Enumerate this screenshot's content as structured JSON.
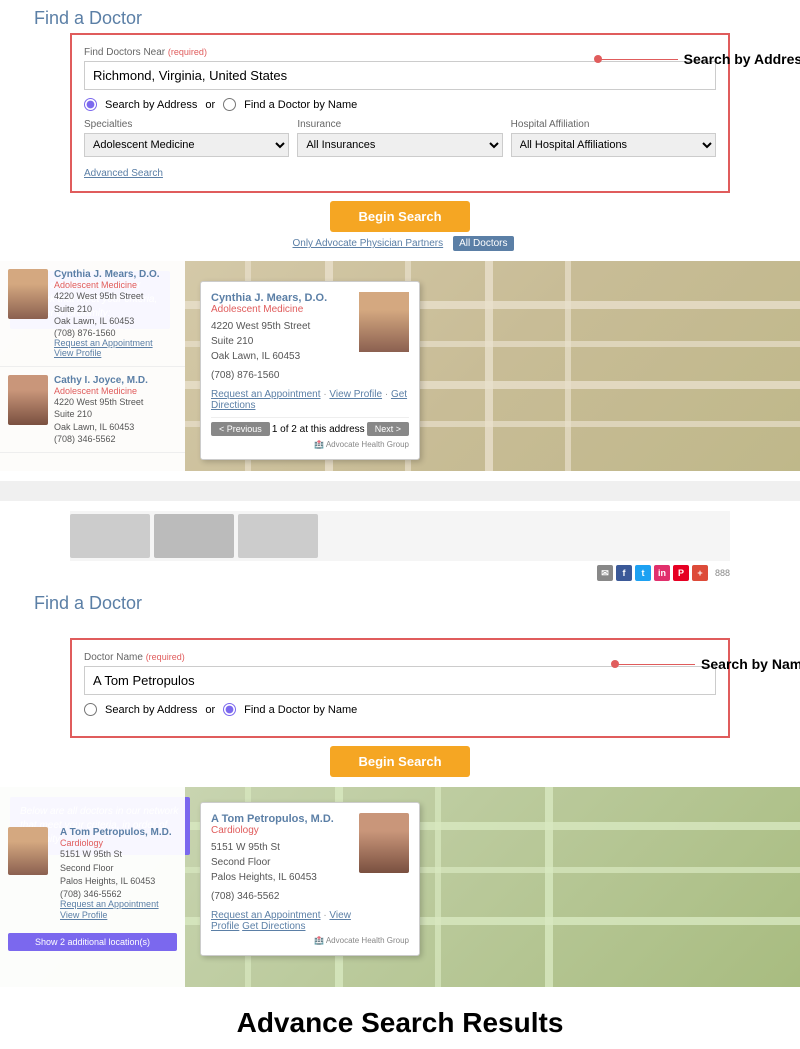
{
  "page": {
    "title1": "Find a Doctor",
    "title2": "Find a Doctor"
  },
  "search1": {
    "form_label": "Find Doctors Near",
    "required_label": "(required)",
    "address_value": "Richmond, Virginia, United States",
    "address_placeholder": "Richmond, Virginia, United States",
    "radio_address": "Search by Address",
    "radio_or": "or",
    "radio_name": "Find a Doctor by Name",
    "specialties_label": "Specialties",
    "insurance_label": "Insurance",
    "hospital_label": "Hospital Affiliation",
    "specialty_value": "Adolescent Medicine",
    "insurance_value": "All Insurances",
    "hospital_value": "All Hospital Affiliations",
    "advanced_link": "Advanced Search",
    "begin_btn": "Begin Search",
    "filter_only": "Only Advocate Physician Partners",
    "filter_all": "All Doctors",
    "annotation": "Search by Address"
  },
  "doctor1": {
    "name": "Cynthia J. Mears, D.O.",
    "specialty": "Adolescent Medicine",
    "address": "4220 West 95th Street\nSuite 210\nOak Lawn, IL 60453",
    "phone": "(708) 876-1560",
    "link_appt": "Request an Appointment",
    "link_profile": "View Profile"
  },
  "doctor2": {
    "name": "Cathy I. Joyce, M.D.",
    "specialty": "Adolescent Medicine",
    "address": "4220 West 95th Street\nSuite 210\nOak Lawn, IL 60453",
    "phone": "(708) 346-5562"
  },
  "popup1": {
    "name": "Cynthia J. Mears, D.O.",
    "specialty": "Adolescent Medicine",
    "address": "4220 West 95th Street\nSuite 210\nOak Lawn, IL 60453",
    "phone": "(708) 876-1560",
    "link_appt": "Request an Appointment",
    "link_profile": "View Profile",
    "link_directions": "Get Directions",
    "nav_prev": "< Previous",
    "nav_info": "1 of 2 at this address",
    "nav_next": "Next >"
  },
  "search2": {
    "form_label": "Doctor Name",
    "required_label": "(required)",
    "name_value": "A Tom Petropulos",
    "name_placeholder": "A Tom Petropulos",
    "radio_address": "Search by Address",
    "radio_or": "or",
    "radio_name": "Find a Doctor by Name",
    "begin_btn": "Begin Search",
    "annotation": "Search by Name"
  },
  "doctor3": {
    "name": "A Tom Petropulos, M.D.",
    "specialty": "Cardiology",
    "address": "5151 W 95th St\nSecond Floor\nPalos Heights, IL 60453",
    "phone": "(708) 346-5562",
    "link_appt": "Request an Appointment",
    "link_profile": "View Profile",
    "link_directions": "Get Directions",
    "show_locations": "Show 2 additional location(s)"
  },
  "advance_title": "Advance Search Results",
  "social": {
    "icons": [
      "✉",
      "f",
      "t",
      "in",
      "P",
      "+"
    ]
  }
}
